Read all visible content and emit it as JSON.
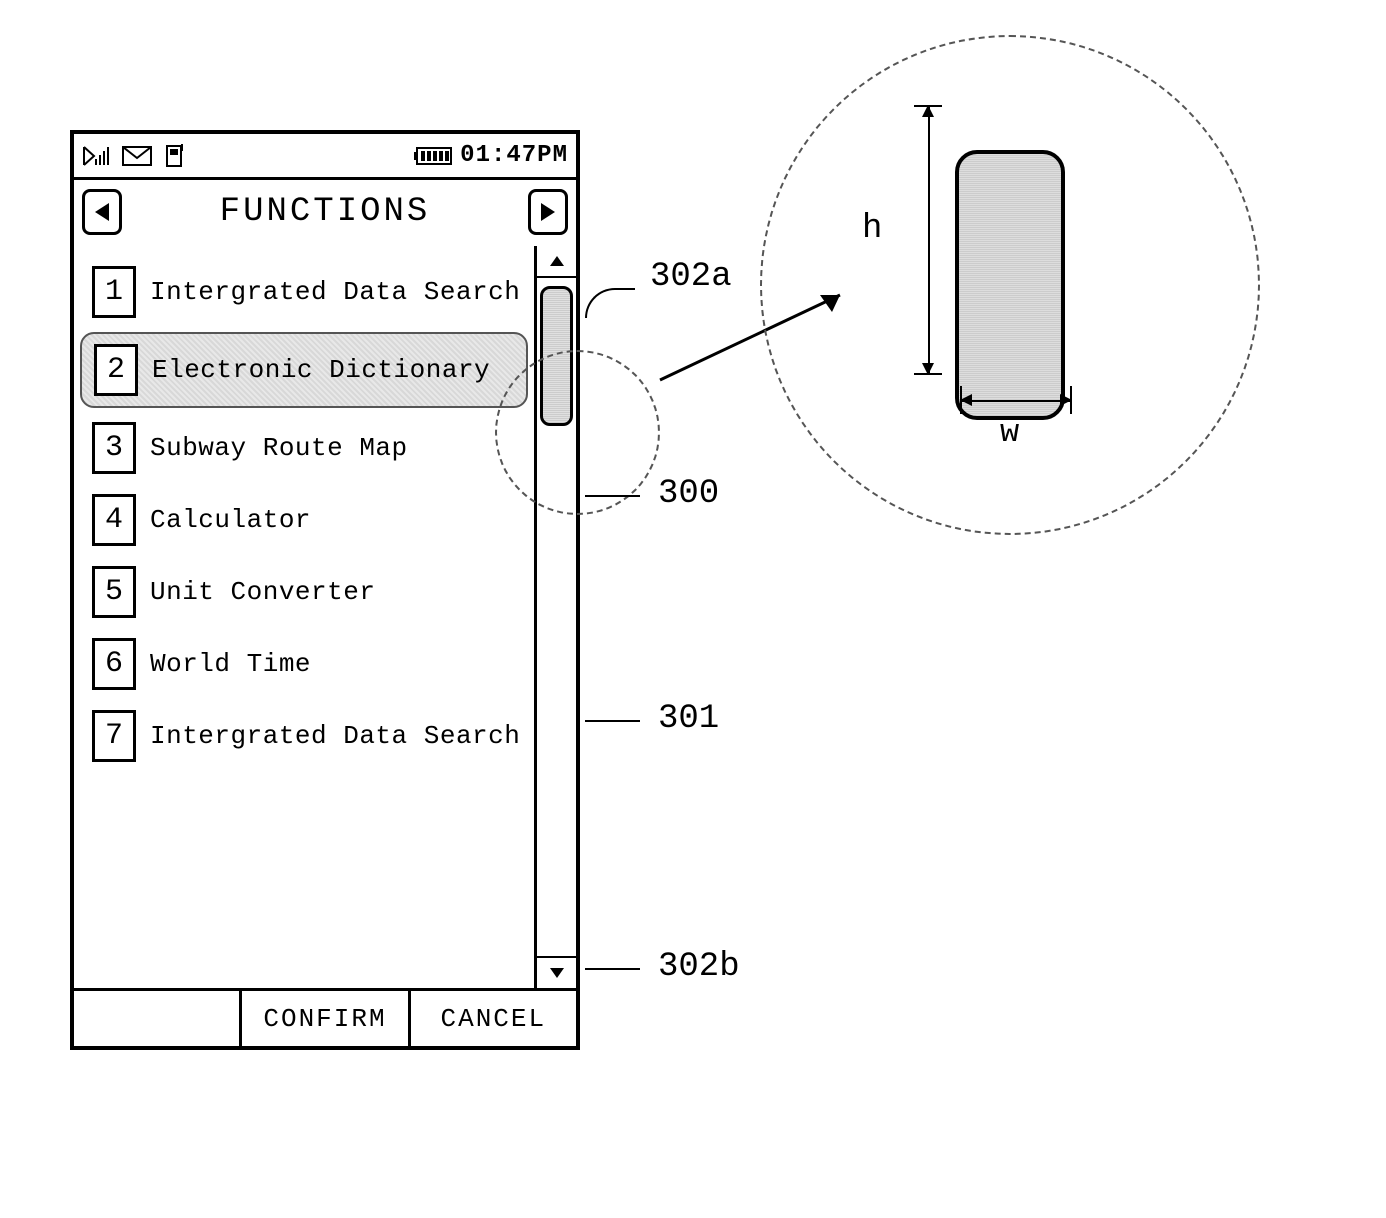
{
  "status": {
    "time": "01:47PM"
  },
  "header": {
    "title": "FUNCTIONS"
  },
  "list": {
    "items": [
      {
        "num": "1",
        "label": "Intergrated Data Search",
        "selected": false
      },
      {
        "num": "2",
        "label": "Electronic Dictionary",
        "selected": true
      },
      {
        "num": "3",
        "label": "Subway Route Map",
        "selected": false
      },
      {
        "num": "4",
        "label": "Calculator",
        "selected": false
      },
      {
        "num": "5",
        "label": "Unit Converter",
        "selected": false
      },
      {
        "num": "6",
        "label": "World Time",
        "selected": false
      },
      {
        "num": "7",
        "label": "Intergrated Data Search",
        "selected": false
      }
    ]
  },
  "softkeys": {
    "left": "",
    "center": "CONFIRM",
    "right": "CANCEL"
  },
  "callouts": {
    "thumb_magnified_h": "h",
    "thumb_magnified_w": "w",
    "ref_302a": "302a",
    "ref_300": "300",
    "ref_301": "301",
    "ref_302b": "302b"
  }
}
